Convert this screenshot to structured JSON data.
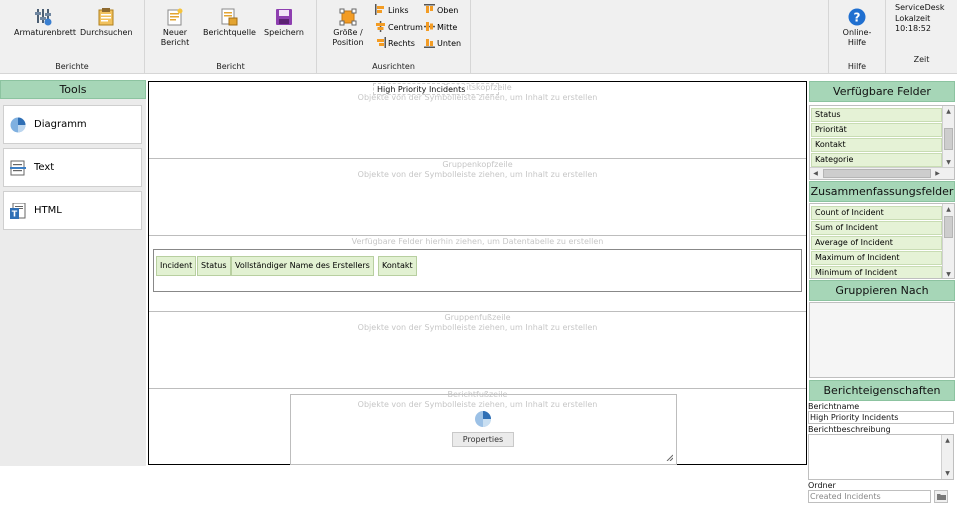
{
  "ribbon": {
    "berichte": {
      "label": "Berichte",
      "armaturenbrett": "Armaturenbrett",
      "durchsuchen": "Durchsuchen"
    },
    "bericht": {
      "label": "Bericht",
      "neuer_bericht_line1": "Neuer",
      "neuer_bericht_line2": "Bericht",
      "berichtquelle": "Berichtquelle",
      "speichern": "Speichern"
    },
    "ausrichten": {
      "label": "Ausrichten",
      "groesse_line1": "Größe /",
      "groesse_line2": "Position",
      "links": "Links",
      "centrum": "Centrum",
      "rechts": "Rechts",
      "oben": "Oben",
      "mitte": "Mitte",
      "unten": "Unten"
    },
    "hilfe": {
      "label": "Hilfe",
      "online_line1": "Online-",
      "online_line2": "Hilfe"
    },
    "zeit": {
      "label": "Zeit",
      "line1": "ServiceDesk",
      "line2": "Lokalzeit",
      "time": "10:18:52"
    }
  },
  "tools": {
    "header": "Tools",
    "items": [
      {
        "label": "Diagramm",
        "icon": "pie-chart-icon"
      },
      {
        "label": "Text",
        "icon": "text-icon"
      },
      {
        "label": "HTML",
        "icon": "html-icon"
      }
    ]
  },
  "canvas": {
    "report_title": "High Priority Incidents",
    "sections": [
      {
        "title": "Berichtskopfzeile",
        "hint": "Objekte von der Symbolleiste ziehen, um Inhalt zu erstellen"
      },
      {
        "title": "Gruppenkopfzeile",
        "hint": "Objekte von der Symbolleiste ziehen, um Inhalt zu erstellen"
      },
      {
        "title": "Verfügbare Felder hierhin ziehen, um Datentabelle zu erstellen",
        "hint": ""
      },
      {
        "title": "Gruppenfußzeile",
        "hint": "Objekte von der Symbolleiste ziehen, um Inhalt zu erstellen"
      },
      {
        "title": "Berichtfußzeile",
        "hint": "Objekte von der Symbolleiste ziehen, um Inhalt zu erstellen"
      }
    ],
    "columns": [
      "Incident",
      "Status",
      "Vollständiger Name des Erstellers",
      "Kontakt"
    ],
    "chart_properties_button": "Properties"
  },
  "right": {
    "available_fields": {
      "header": "Verfügbare Felder",
      "items": [
        "Status",
        "Priorität",
        "Kontakt",
        "Kategorie"
      ]
    },
    "summary_fields": {
      "header": "Zusammenfassungsfelder",
      "items": [
        "Count of Incident",
        "Sum of Incident",
        "Average of Incident",
        "Maximum of Incident",
        "Minimum of Incident"
      ]
    },
    "group_by": {
      "header": "Gruppieren Nach"
    },
    "report_properties": {
      "header": "Berichteigenschaften",
      "name_label": "Berichtname",
      "name_value": "High Priority Incidents",
      "description_label": "Berichtbeschreibung",
      "description_value": "",
      "folder_label": "Ordner",
      "folder_value": "Created Incidents"
    }
  },
  "colors": {
    "panel_header": "#a6d6b7",
    "field_item": "#e5f2d6",
    "ribbon_bg": "#f0f0f0",
    "hint_text": "#c6c6c6"
  }
}
